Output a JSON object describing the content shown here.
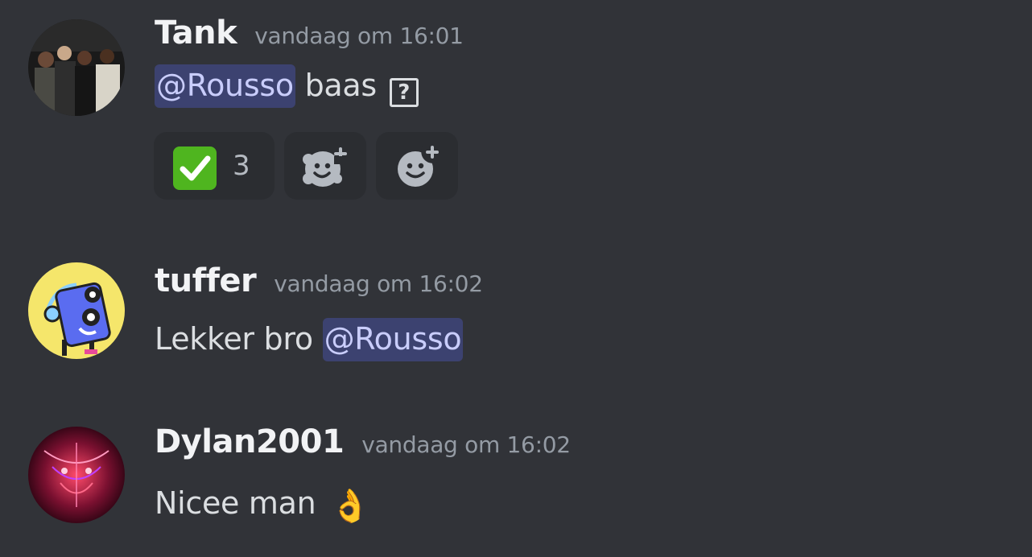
{
  "messages": [
    {
      "username": "Tank",
      "timestamp": "vandaag om 16:01",
      "mention": "@Rousso",
      "text_after": "baas",
      "unknown_glyph": "?",
      "reactions": [
        {
          "emoji": "check-mark",
          "count": "3"
        },
        {
          "emoji": "add-super-reaction-icon"
        },
        {
          "emoji": "add-reaction-icon"
        }
      ]
    },
    {
      "username": "tuffer",
      "timestamp": "vandaag om 16:02",
      "text_before": "Lekker bro",
      "mention": "@Rousso"
    },
    {
      "username": "Dylan2001",
      "timestamp": "vandaag om 16:02",
      "text": "Nicee man",
      "emoji": "👌"
    }
  ],
  "colors": {
    "background": "#313338",
    "mention_bg": "#3c4270",
    "mention_text": "#c9cdfb",
    "reaction_bg": "#2b2d31",
    "timestamp": "#949ba4"
  }
}
